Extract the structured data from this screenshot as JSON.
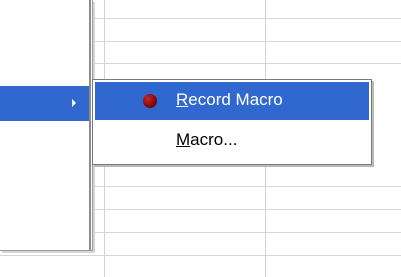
{
  "submenu": {
    "items": [
      {
        "label": "Record Macro",
        "mnemonic": "R",
        "icon": "record-dot-icon",
        "highlighted": true
      },
      {
        "label": "Macro...",
        "mnemonic": "M",
        "icon": "",
        "highlighted": false
      }
    ]
  },
  "colors": {
    "highlight": "#3168cf",
    "record_dot": "#9b0a0a",
    "grid": "#d4d6da"
  }
}
